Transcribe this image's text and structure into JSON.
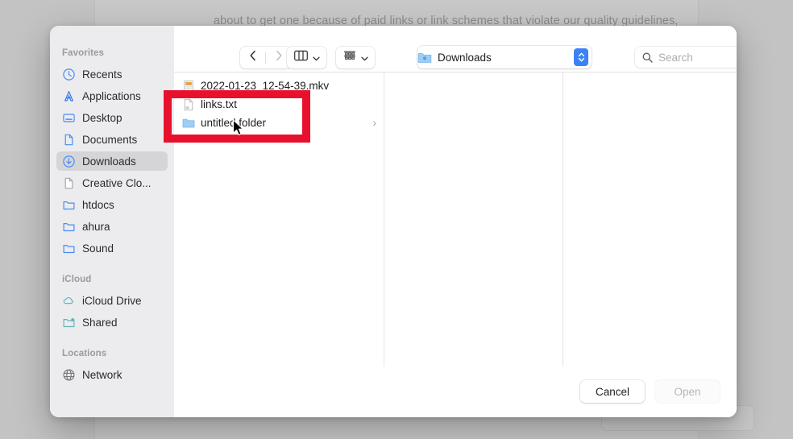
{
  "backdrop": {
    "paragraph_text": "about to get one because of paid links or link schemes that violate our quality guidelines,"
  },
  "dialog": {
    "sidebar": {
      "sections": [
        {
          "header": "Favorites",
          "items": [
            {
              "label": "Recents",
              "icon": "clock-icon",
              "selected": false
            },
            {
              "label": "Applications",
              "icon": "applications-icon",
              "selected": false
            },
            {
              "label": "Desktop",
              "icon": "desktop-icon",
              "selected": false
            },
            {
              "label": "Documents",
              "icon": "document-icon",
              "selected": false
            },
            {
              "label": "Downloads",
              "icon": "downloads-icon",
              "selected": true
            },
            {
              "label": "Creative Clo...",
              "icon": "document-grey-icon",
              "selected": false
            },
            {
              "label": "htdocs",
              "icon": "folder-icon",
              "selected": false
            },
            {
              "label": "ahura",
              "icon": "folder-icon",
              "selected": false
            },
            {
              "label": "Sound",
              "icon": "folder-icon",
              "selected": false
            }
          ]
        },
        {
          "header": "iCloud",
          "items": [
            {
              "label": "iCloud Drive",
              "icon": "cloud-icon",
              "selected": false
            },
            {
              "label": "Shared",
              "icon": "shared-folder-icon",
              "selected": false
            }
          ]
        },
        {
          "header": "Locations",
          "items": [
            {
              "label": "Network",
              "icon": "globe-icon",
              "selected": false
            }
          ]
        }
      ]
    },
    "toolbar": {
      "back_icon": "chevron-left-icon",
      "forward_icon": "chevron-right-icon",
      "view_icon": "column-view-icon",
      "view_chevron_icon": "chevron-down-icon",
      "group_icon": "group-by-icon",
      "group_chevron_icon": "chevron-down-icon",
      "path_label": "Downloads",
      "path_icon": "downloads-folder-icon",
      "stepper_icon": "up-down-stepper-icon",
      "search_icon": "search-icon",
      "search_placeholder": "Search",
      "search_value": ""
    },
    "file_list": [
      {
        "name": "2022-01-23_12-54-39.mkv",
        "icon": "movie-file-icon",
        "has_chevron": false
      },
      {
        "name": "links.txt",
        "icon": "text-file-icon",
        "has_chevron": false
      },
      {
        "name": "untitled folder",
        "icon": "folder-icon",
        "has_chevron": true,
        "chevron_glyph": "›"
      }
    ],
    "footer": {
      "cancel_label": "Cancel",
      "open_label": "Open"
    }
  },
  "annotation": {
    "shape": "rectangle",
    "color": "#e8112d"
  },
  "cursor": {
    "icon": "mouse-pointer-icon"
  }
}
